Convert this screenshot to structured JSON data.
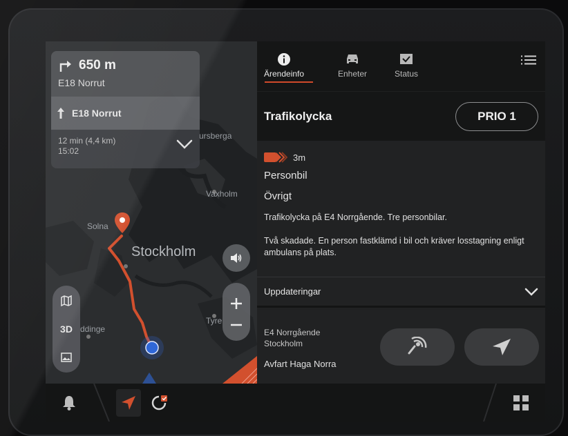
{
  "map": {
    "labels": {
      "ursberga": "ursberga",
      "vaxholm": "Vaxholm",
      "solna": "Solna",
      "stockholm": "Stockholm",
      "tyre": "Tyre",
      "addinge": "ddinge"
    },
    "nav": {
      "distance": "650 m",
      "road": "E18 Norrut",
      "next_road": "E18 Norrut",
      "eta": "12 min (4,4 km)",
      "arrival": "15:02",
      "turn_icon": "turn-right-icon",
      "straight_icon": "arrow-up-icon",
      "expand_icon": "chevron-down-icon"
    },
    "view_mode": {
      "map_icon": "map-icon",
      "label_3d": "3D",
      "satellite_icon": "image-icon"
    },
    "volume_icon": "speaker-icon",
    "zoom_in_icon": "plus-icon",
    "zoom_out_icon": "minus-icon",
    "route_color": "#d2502e",
    "pin_color": "#d2502e",
    "position_color": "#2f67d8"
  },
  "panel": {
    "tabs": [
      {
        "label": "Ärendeinfo",
        "icon": "info-icon",
        "active": true
      },
      {
        "label": "Enheter",
        "icon": "car-icon",
        "active": false
      },
      {
        "label": "Status",
        "icon": "check-box-icon",
        "active": false
      }
    ],
    "menu_icon": "list-icon",
    "title": "Trafikolycka",
    "priority": "PRIO 1",
    "age": "3m",
    "vehicle_type": "Personbil",
    "category": "Övrigt",
    "description_1": "Trafikolycka på E4 Norrgående. Tre personbilar.",
    "description_2": "Två skadade. En person fastklämd i bil och kräver losstagning enligt ambulans på plats.",
    "updates_label": "Uppdateringar",
    "address": {
      "line1": "E4 Norrgående",
      "line2": "Stockholm",
      "exit": "Avfart Haga Norra"
    },
    "action_buttons": [
      {
        "icon": "radio-signal-icon"
      },
      {
        "icon": "navigate-icon"
      }
    ],
    "accent_color": "#d24a2a"
  },
  "bottom_bar": {
    "bell_icon": "bell-icon",
    "navigate_icon": "navigate-icon",
    "refresh_icon": "refresh-icon",
    "apps_icon": "grid-icon"
  }
}
